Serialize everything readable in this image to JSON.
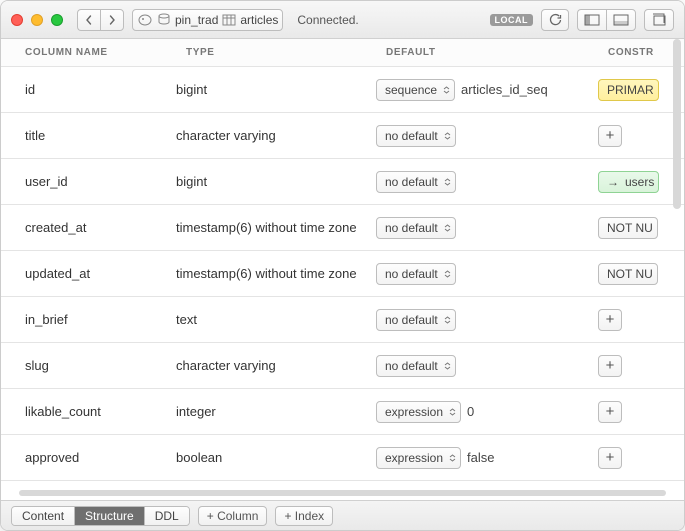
{
  "titlebar": {
    "history": {
      "back": "‹",
      "forward": "›"
    },
    "breadcrumb": {
      "db": "pin_trad",
      "table": "articles"
    },
    "status": "Connected.",
    "badge": "LOCAL"
  },
  "headers": {
    "column_name": "COLUMN NAME",
    "type": "TYPE",
    "default": "DEFAULT",
    "constraints": "CONSTR"
  },
  "columns": [
    {
      "name": "id",
      "type": "bigint",
      "default_kind": "sequence",
      "default_value": "articles_id_seq",
      "constraint": {
        "kind": "primary",
        "label": "PRIMAR"
      }
    },
    {
      "name": "title",
      "type": "character varying",
      "default_kind": "no default",
      "default_value": "",
      "constraint": {
        "kind": "plus",
        "label": ""
      }
    },
    {
      "name": "user_id",
      "type": "bigint",
      "default_kind": "no default",
      "default_value": "",
      "constraint": {
        "kind": "fk",
        "label": "users"
      }
    },
    {
      "name": "created_at",
      "type": "timestamp(6) without time zone",
      "default_kind": "no default",
      "default_value": "",
      "constraint": {
        "kind": "notnull",
        "label": "NOT NU"
      }
    },
    {
      "name": "updated_at",
      "type": "timestamp(6) without time zone",
      "default_kind": "no default",
      "default_value": "",
      "constraint": {
        "kind": "notnull",
        "label": "NOT NU"
      }
    },
    {
      "name": "in_brief",
      "type": "text",
      "default_kind": "no default",
      "default_value": "",
      "constraint": {
        "kind": "plus",
        "label": ""
      }
    },
    {
      "name": "slug",
      "type": "character varying",
      "default_kind": "no default",
      "default_value": "",
      "constraint": {
        "kind": "plus",
        "label": ""
      }
    },
    {
      "name": "likable_count",
      "type": "integer",
      "default_kind": "expression",
      "default_value": "0",
      "constraint": {
        "kind": "plus",
        "label": ""
      }
    },
    {
      "name": "approved",
      "type": "boolean",
      "default_kind": "expression",
      "default_value": "false",
      "constraint": {
        "kind": "plus",
        "label": ""
      }
    }
  ],
  "bottom": {
    "tabs": [
      "Content",
      "Structure",
      "DDL"
    ],
    "active_tab": "Structure",
    "add_column": "+ Column",
    "add_index": "+ Index"
  }
}
